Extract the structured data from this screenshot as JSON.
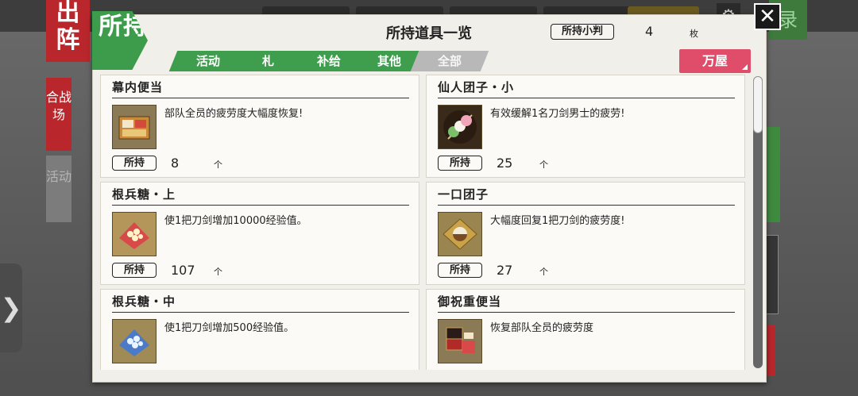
{
  "background": {
    "sortie": "出阵",
    "side_red": "合战场",
    "side_gray": "活动",
    "right_green": "录",
    "handle": "❯"
  },
  "badge": "所持",
  "title": "所持道具一览",
  "koban": {
    "label": "所持小判",
    "count": "4",
    "unit": "枚"
  },
  "tabs": [
    {
      "label": "活动",
      "active": false
    },
    {
      "label": "札",
      "active": false
    },
    {
      "label": "补给",
      "active": false
    },
    {
      "label": "其他",
      "active": false
    },
    {
      "label": "全部",
      "active": true
    }
  ],
  "shop_label": "万屋",
  "close_label": "✕",
  "own_label": "所持",
  "items": [
    {
      "name": "幕内便当",
      "desc": "部队全员的疲劳度大幅度恢复!",
      "count": "8",
      "unit": "个",
      "icon": "bento-box-icon"
    },
    {
      "name": "仙人团子・小",
      "desc": "有效缓解1名刀剑男士的疲劳!",
      "count": "25",
      "unit": "个",
      "icon": "dango-icon"
    },
    {
      "name": "根兵糖・上",
      "desc": "使1把刀剑增加10000经验值。",
      "count": "107",
      "unit": "个",
      "icon": "konpeito-icon"
    },
    {
      "name": "一口团子",
      "desc": "大幅度回复1把刀剑的疲劳度!",
      "count": "27",
      "unit": "个",
      "icon": "dumpling-icon"
    },
    {
      "name": "根兵糖・中",
      "desc": "使1把刀剑增加500经验值。",
      "count": "",
      "unit": "",
      "icon": "konpeito-icon"
    },
    {
      "name": "御祝重便当",
      "desc": "恢复部队全员的疲劳度",
      "count": "",
      "unit": "",
      "icon": "celebration-bento-icon"
    }
  ]
}
